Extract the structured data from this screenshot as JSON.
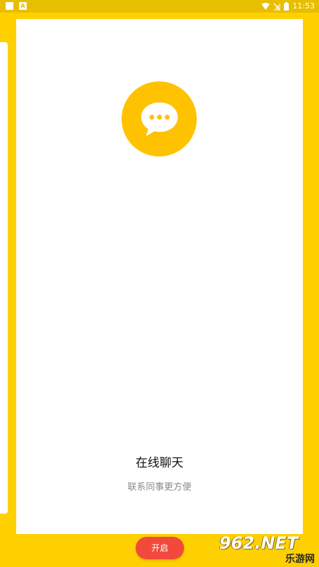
{
  "status_bar": {
    "time": "11:53",
    "left_icons": [
      "square-icon",
      "a-icon"
    ],
    "a_glyph": "A",
    "right_icons": [
      "wifi-icon",
      "signal-icon",
      "battery-icon"
    ]
  },
  "card": {
    "icon": "chat-bubble-icon",
    "title": "在线聊天",
    "subtitle": "联系同事更方便"
  },
  "button": {
    "label": "开启"
  },
  "watermark": {
    "line1": "962.NET",
    "line2": "乐游网"
  },
  "colors": {
    "background": "#FFD000",
    "accent": "#FFC200",
    "button": "#F2493D"
  }
}
